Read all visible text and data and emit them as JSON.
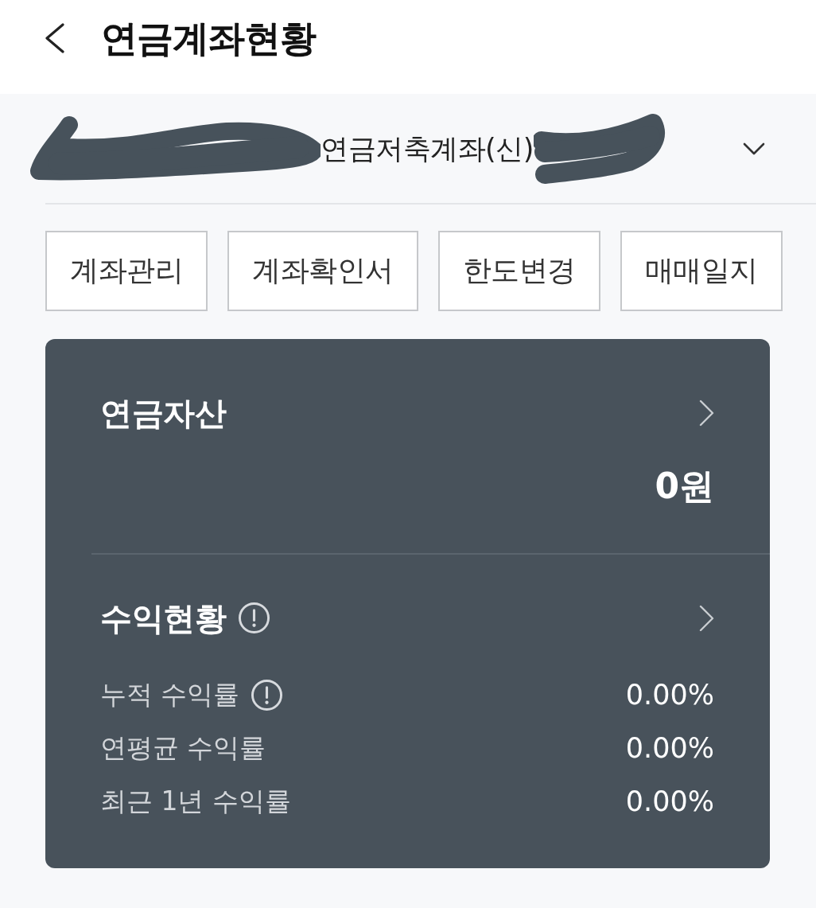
{
  "header": {
    "title": "연금계좌현황"
  },
  "account_selector": {
    "name": "연금저축계좌(신)",
    "redacted": true
  },
  "actions": [
    {
      "label": "계좌관리"
    },
    {
      "label": "계좌확인서"
    },
    {
      "label": "한도변경"
    },
    {
      "label": "매매일지"
    }
  ],
  "pension_assets": {
    "title": "연금자산",
    "amount": "0원"
  },
  "returns": {
    "title": "수익현황",
    "info_icon": true,
    "rows": [
      {
        "label": "누적 수익률",
        "info_icon": true,
        "value": "0.00%"
      },
      {
        "label": "연평균 수익률",
        "info_icon": false,
        "value": "0.00%"
      },
      {
        "label": "최근 1년 수익률",
        "info_icon": false,
        "value": "0.00%"
      }
    ]
  }
}
